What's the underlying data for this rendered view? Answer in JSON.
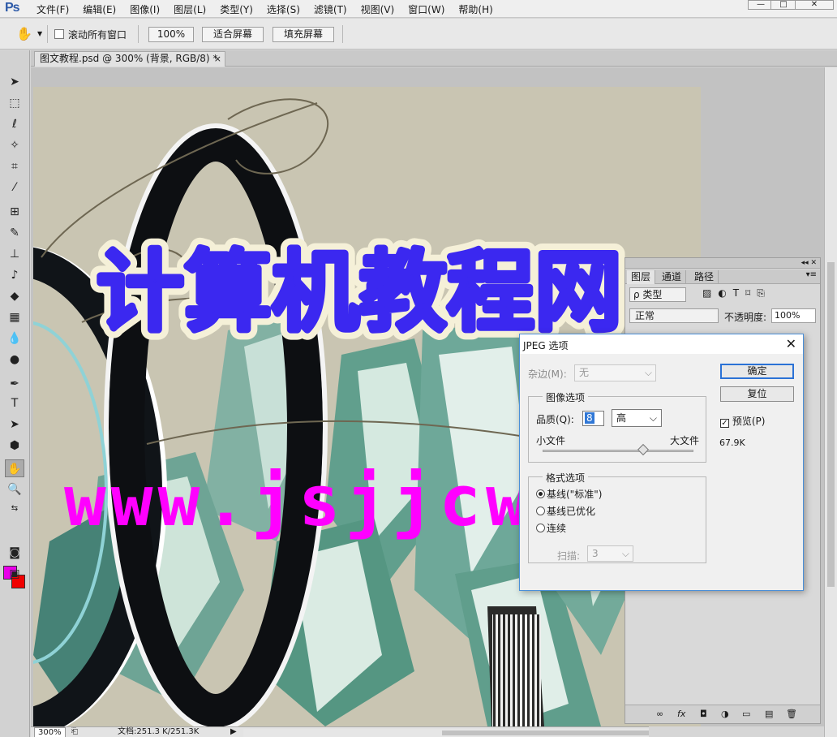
{
  "app": {
    "logo": "Ps",
    "menu": [
      "文件(F)",
      "编辑(E)",
      "图像(I)",
      "图层(L)",
      "类型(Y)",
      "选择(S)",
      "滤镜(T)",
      "视图(V)",
      "窗口(W)",
      "帮助(H)"
    ],
    "window_buttons": {
      "minimize": "—",
      "restore": "□",
      "close": "✕"
    }
  },
  "options_bar": {
    "scroll_all_windows_label": "滚动所有窗口",
    "zoom_100_label": "100%",
    "fit_screen_label": "适合屏幕",
    "fill_screen_label": "填充屏幕"
  },
  "document": {
    "tab_title": "图文教程.psd @ 300% (背景, RGB/8) *",
    "tab_close": "×",
    "canvas_headline": "计算机教程网",
    "canvas_url": "www.jsjjcw.c"
  },
  "status": {
    "zoom": "300%",
    "doc_size": "文档:251.3 K/251.3K",
    "arrow": "▶"
  },
  "layers_panel": {
    "tabs": [
      "图层",
      "通道",
      "路径"
    ],
    "kind_filter": "ρ 类型",
    "blend_mode": "正常",
    "opacity_label": "不透明度:",
    "opacity_value": "100%",
    "footer_icons": [
      "∞",
      "fx",
      "◘",
      "◑",
      "▭",
      "▤",
      "🗑"
    ]
  },
  "jpeg_dialog": {
    "title": "JPEG 选项",
    "close": "✕",
    "matte_label": "杂边(M):",
    "matte_value": "无",
    "image_options_legend": "图像选项",
    "quality_label": "品质(Q):",
    "quality_value": "8",
    "quality_preset": "高",
    "small_file_label": "小文件",
    "large_file_label": "大文件",
    "quality_slider_fraction": 0.667,
    "format_options_legend": "格式选项",
    "format_options": [
      "基线(\"标准\")",
      "基线已优化",
      "连续"
    ],
    "selected_format": 0,
    "scans_label": "扫描:",
    "scans_value": "3",
    "ok_label": "确定",
    "reset_label": "复位",
    "preview_label": "预览(P)",
    "preview_checked": true,
    "file_size": "67.9K"
  },
  "colors": {
    "foreground": "#e800e8",
    "background": "#f00000",
    "headline": "#3b28f0",
    "url_text": "#ff00ff"
  }
}
